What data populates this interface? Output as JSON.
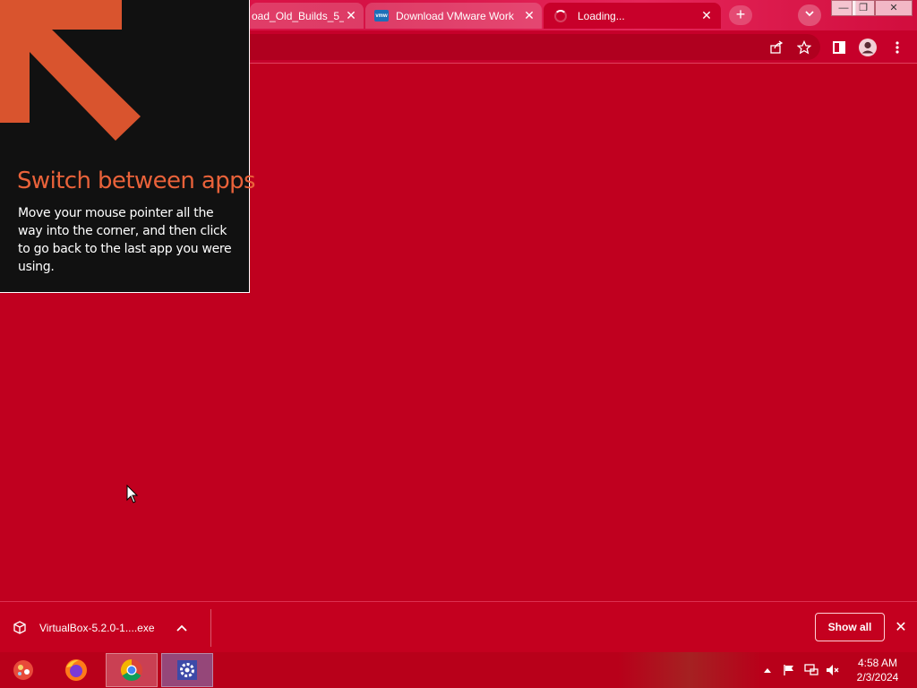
{
  "browser": {
    "tabs": [
      {
        "title": "oad_Old_Builds_5_",
        "close": "✕"
      },
      {
        "title": "Download VMware Work",
        "close": "✕",
        "favicon_text": "vmw"
      },
      {
        "title": "Loading...",
        "close": "✕"
      }
    ],
    "new_tab_label": "+",
    "window_controls": {
      "minimize": "—",
      "restore": "❐",
      "close": "✕"
    }
  },
  "hint": {
    "title": "Switch between apps",
    "body": "Move your mouse pointer all the way into the corner, and then click to go back to the last app you were using."
  },
  "download_shelf": {
    "item_name": "VirtualBox-5.2.0-1....exe",
    "show_all": "Show all",
    "close": "✕"
  },
  "taskbar": {
    "apps": [
      "start-orb",
      "firefox",
      "chrome",
      "settings"
    ],
    "clock": {
      "time": "4:58 AM",
      "date": "2/3/2024"
    }
  },
  "colors": {
    "page_bg": "#c0001f",
    "hint_bg": "#111111",
    "hint_title": "#e9623a",
    "arrow": "#d9542e"
  }
}
